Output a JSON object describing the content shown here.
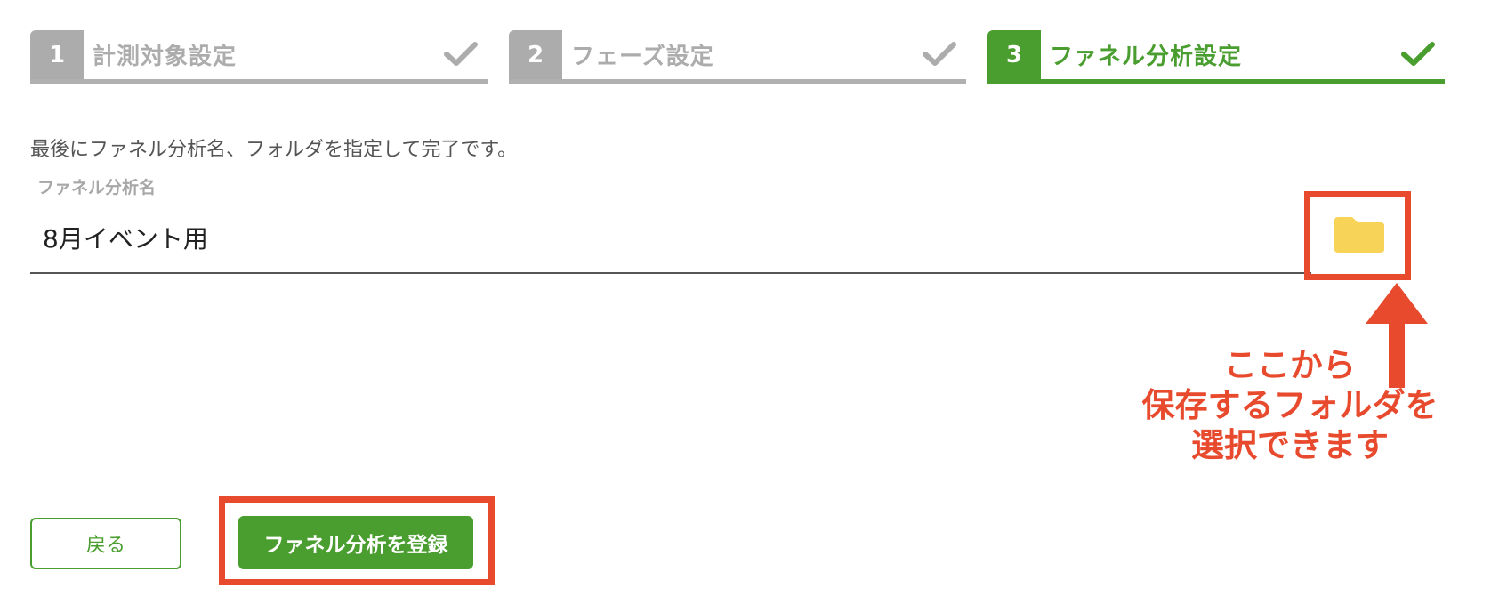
{
  "steps": [
    {
      "number": "1",
      "label": "計測対象設定",
      "status": "complete"
    },
    {
      "number": "2",
      "label": "フェーズ設定",
      "status": "complete"
    },
    {
      "number": "3",
      "label": "ファネル分析設定",
      "status": "active"
    }
  ],
  "instruction": "最後にファネル分析名、フォルダを指定して完了です。",
  "form": {
    "name_label": "ファネル分析名",
    "name_value": "8月イベント用"
  },
  "annotation": {
    "lines": [
      "ここから",
      "保存するフォルダを",
      "選択できます"
    ]
  },
  "buttons": {
    "back_label": "戻る",
    "register_label": "ファネル分析を登録"
  },
  "icons": {
    "folder": "folder-icon",
    "check": "check-icon",
    "arrow": "arrow-up-icon"
  },
  "colors": {
    "accent_green": "#4a9e2f",
    "inactive_gray": "#acacac",
    "highlight_red": "#e84a2e",
    "folder_yellow": "#f7d358"
  }
}
